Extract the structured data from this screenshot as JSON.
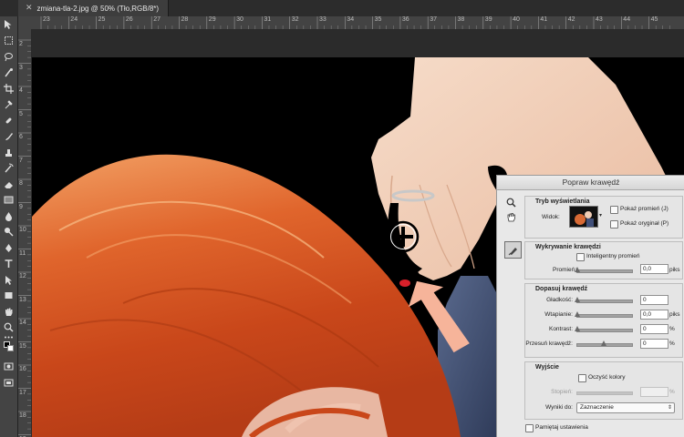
{
  "document_tab": {
    "title": "zmiana-tla-2.jpg @ 50% (Tło,RGB/8*)",
    "close_glyph": "✕"
  },
  "ruler": {
    "top_labels": [
      "23",
      "24",
      "25",
      "26",
      "27",
      "28",
      "29",
      "30",
      "31",
      "32",
      "33",
      "34",
      "35",
      "36",
      "37",
      "38",
      "39",
      "40",
      "41",
      "42",
      "43",
      "44",
      "45"
    ],
    "left_labels": [
      "2",
      "3",
      "4",
      "5",
      "6",
      "7",
      "8",
      "9",
      "10",
      "11",
      "12",
      "13",
      "14",
      "15",
      "16",
      "17",
      "18",
      "19"
    ]
  },
  "toolbar_icons": [
    "move-icon",
    "marquee-icon",
    "lasso-icon",
    "quick-select-icon",
    "crop-icon",
    "eyedropper-icon",
    "healing-brush-icon",
    "brush-icon",
    "clone-stamp-icon",
    "history-brush-icon",
    "eraser-icon",
    "gradient-icon",
    "blur-icon",
    "dodge-icon",
    "pen-icon",
    "type-icon",
    "path-select-icon",
    "shape-icon",
    "hand-icon",
    "zoom-icon",
    "more-tools-icon",
    "color-swatches-icon",
    "quick-mask-icon",
    "screen-mode-icon"
  ],
  "overlay": {
    "arrow_color": "#f6b49a",
    "highlight_color": "#f6b49a"
  },
  "dialog": {
    "title": "Popraw krawędź",
    "view_mode": {
      "title": "Tryb wyświetlania",
      "view_label": "Widok:",
      "show_radius": "Pokaż promień (J)",
      "show_original": "Pokaż oryginał (P)"
    },
    "edge_detection": {
      "title": "Wykrywanie krawędzi",
      "smart_radius": "Inteligentny promień",
      "radius_label": "Promień:",
      "radius_value": "0,0",
      "radius_unit": "piks"
    },
    "adjust_edge": {
      "title": "Dopasuj krawędź",
      "smooth_label": "Gładkość:",
      "smooth_value": "0",
      "feather_label": "Wtapianie:",
      "feather_value": "0,0",
      "feather_unit": "piks",
      "contrast_label": "Kontrast:",
      "contrast_value": "0",
      "contrast_unit": "%",
      "shift_label": "Przesuń krawędź:",
      "shift_value": "0",
      "shift_unit": "%"
    },
    "output": {
      "title": "Wyjście",
      "decontaminate": "Oczyść kolory",
      "amount_label": "Stopień:",
      "amount_unit": "%",
      "output_to_label": "Wyniki do:",
      "output_to_value": "Zaznaczenie"
    },
    "remember": "Pamiętaj ustawienia"
  }
}
